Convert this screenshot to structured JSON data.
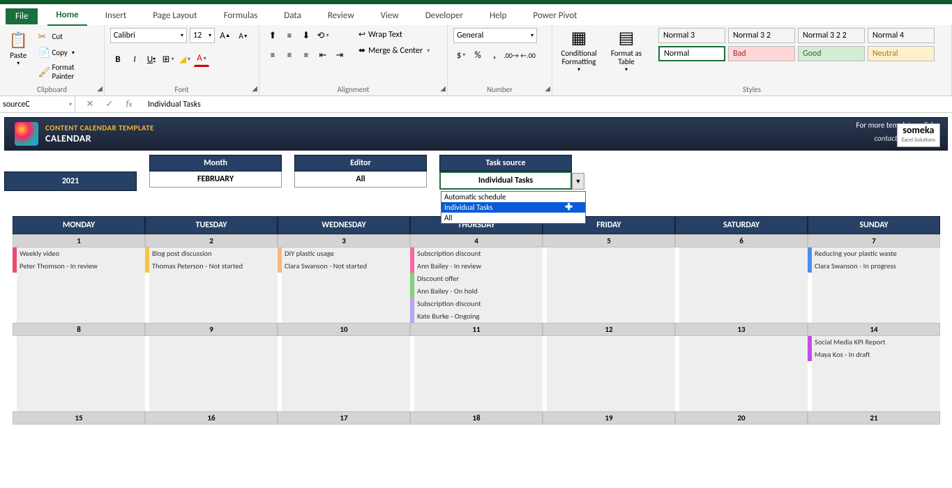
{
  "tabs": [
    "File",
    "Home",
    "Insert",
    "Page Layout",
    "Formulas",
    "Data",
    "Review",
    "View",
    "Developer",
    "Help",
    "Power Pivot"
  ],
  "active_tab": "Home",
  "ribbon": {
    "clipboard": {
      "paste": "Paste",
      "cut": "Cut",
      "copy": "Copy",
      "painter": "Format Painter",
      "group": "Clipboard"
    },
    "font": {
      "name": "Calibri",
      "size": "12",
      "group": "Font"
    },
    "alignment": {
      "wrap": "Wrap Text",
      "merge": "Merge & Center",
      "group": "Alignment"
    },
    "number": {
      "format": "General",
      "group": "Number"
    },
    "styles": {
      "cond": "Conditional Formatting",
      "asTable": "Format as Table",
      "group": "Styles",
      "gal": [
        "Normal 3",
        "Normal 3 2",
        "Normal 3 2 2",
        "Normal 4",
        "Normal",
        "Bad",
        "Good",
        "Neutral"
      ]
    }
  },
  "formula_bar": {
    "namebox": "sourceC",
    "value": "Individual Tasks"
  },
  "header": {
    "title": "CONTENT CALENDAR TEMPLATE",
    "subtitle": "CALENDAR",
    "rt": "For more templates, click >",
    "email": "contact@someka.net",
    "brand": "someka",
    "brand_sub": "Excel Solutions"
  },
  "filters": {
    "year": "2021",
    "month_h": "Month",
    "month_v": "FEBRUARY",
    "editor_h": "Editor",
    "editor_v": "All",
    "task_h": "Task source",
    "task_v": "Individual Tasks",
    "dd_opts": [
      "Automatic schedule",
      "Individual Tasks",
      "All"
    ]
  },
  "days": [
    "MONDAY",
    "TUESDAY",
    "WEDNESDAY",
    "THURSDAY",
    "FRIDAY",
    "SATURDAY",
    "SUNDAY"
  ],
  "weeks": [
    {
      "nums": [
        "1",
        "2",
        "3",
        "4",
        "5",
        "6",
        "7"
      ]
    },
    {
      "nums": [
        "8",
        "9",
        "10",
        "11",
        "12",
        "13",
        "14"
      ]
    },
    {
      "nums": [
        "15",
        "16",
        "17",
        "18",
        "19",
        "20",
        "21"
      ]
    }
  ],
  "tasks": {
    "w0": {
      "r0": [
        {
          "c": "c-red",
          "t": "Weekly video"
        },
        {
          "c": "c-yel",
          "t": "Blog post discussion"
        },
        {
          "c": "c-orn",
          "t": "DIY plastic usage"
        },
        {
          "c": "c-pnk",
          "t": "Subscription discount"
        },
        null,
        null,
        {
          "c": "c-blu",
          "t": "Reducing your plastic waste"
        }
      ],
      "r1": [
        {
          "c": "c-red",
          "t": "Peter Thomson - In review"
        },
        {
          "c": "c-yel",
          "t": "Thomas Peterson - Not started"
        },
        {
          "c": "c-orn",
          "t": "Clara Swanson - Not started"
        },
        {
          "c": "c-pnk",
          "t": "Ann Bailey - In review"
        },
        null,
        null,
        {
          "c": "c-blu",
          "t": "Clara Swanson - In progress"
        }
      ],
      "r2": [
        null,
        null,
        null,
        {
          "c": "c-grn",
          "t": "Discount offer"
        },
        null,
        null,
        null
      ],
      "r3": [
        null,
        null,
        null,
        {
          "c": "c-grn",
          "t": "Ann Bailey - On hold"
        },
        null,
        null,
        null
      ],
      "r4": [
        null,
        null,
        null,
        {
          "c": "c-pur",
          "t": "Subscription discount"
        },
        null,
        null,
        null
      ],
      "r5": [
        null,
        null,
        null,
        {
          "c": "c-pur",
          "t": "Kate Burke - Ongoing"
        },
        null,
        null,
        null
      ]
    },
    "w1": {
      "r0": [
        null,
        null,
        null,
        null,
        null,
        null,
        {
          "c": "c-mag",
          "t": "Social Media KPI Report"
        }
      ],
      "r1": [
        null,
        null,
        null,
        null,
        null,
        null,
        {
          "c": "c-mag",
          "t": "Maya Kos - In draft"
        }
      ],
      "r2": [
        null,
        null,
        null,
        null,
        null,
        null,
        null
      ],
      "r3": [
        null,
        null,
        null,
        null,
        null,
        null,
        null
      ],
      "r4": [
        null,
        null,
        null,
        null,
        null,
        null,
        null
      ],
      "r5": [
        null,
        null,
        null,
        null,
        null,
        null,
        null
      ]
    }
  }
}
